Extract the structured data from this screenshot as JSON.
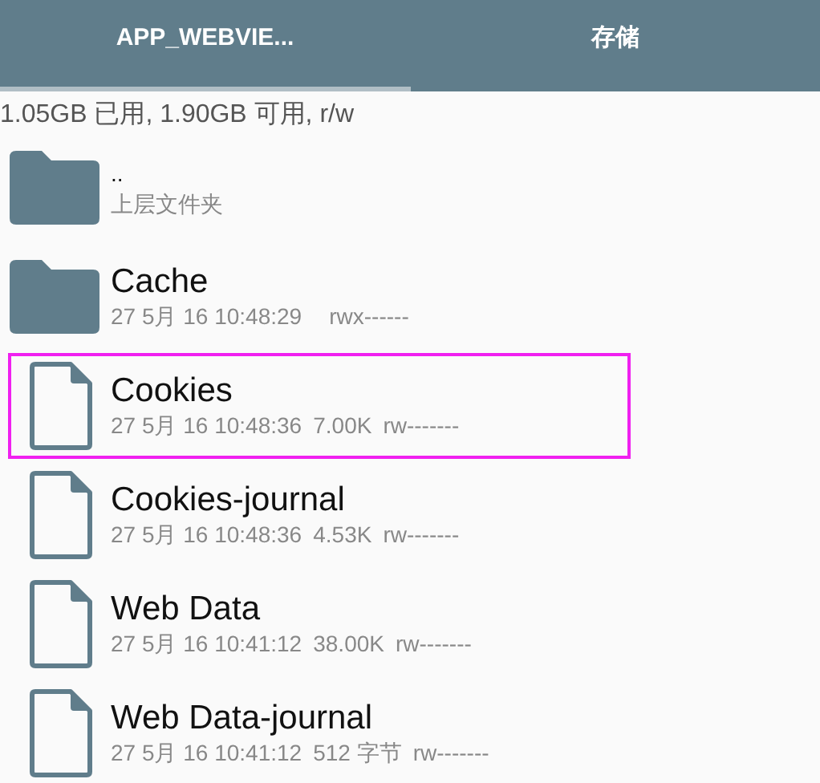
{
  "tabs": [
    {
      "label": "APP_WEBVIE...",
      "selected": true
    },
    {
      "label": "存储",
      "selected": false
    }
  ],
  "storage_info": "1.05GB 已用, 1.90GB 可用, r/w",
  "files": [
    {
      "kind": "folder",
      "name": "..",
      "subtitle": "上层文件夹",
      "selected": false
    },
    {
      "kind": "folder",
      "name": "Cache",
      "date": "27 5月 16 10:48:29",
      "permissions": "rwx------",
      "selected": false
    },
    {
      "kind": "file",
      "name": "Cookies",
      "date": "27 5月 16 10:48:36",
      "size": "7.00K",
      "permissions": "rw-------",
      "selected": true
    },
    {
      "kind": "file",
      "name": "Cookies-journal",
      "date": "27 5月 16 10:48:36",
      "size": "4.53K",
      "permissions": "rw-------",
      "selected": false
    },
    {
      "kind": "file",
      "name": "Web Data",
      "date": "27 5月 16 10:41:12",
      "size": "38.00K",
      "permissions": "rw-------",
      "selected": false
    },
    {
      "kind": "file",
      "name": "Web Data-journal",
      "date": "27 5月 16 10:41:12",
      "size": "512 字节",
      "permissions": "rw-------",
      "selected": false
    }
  ]
}
